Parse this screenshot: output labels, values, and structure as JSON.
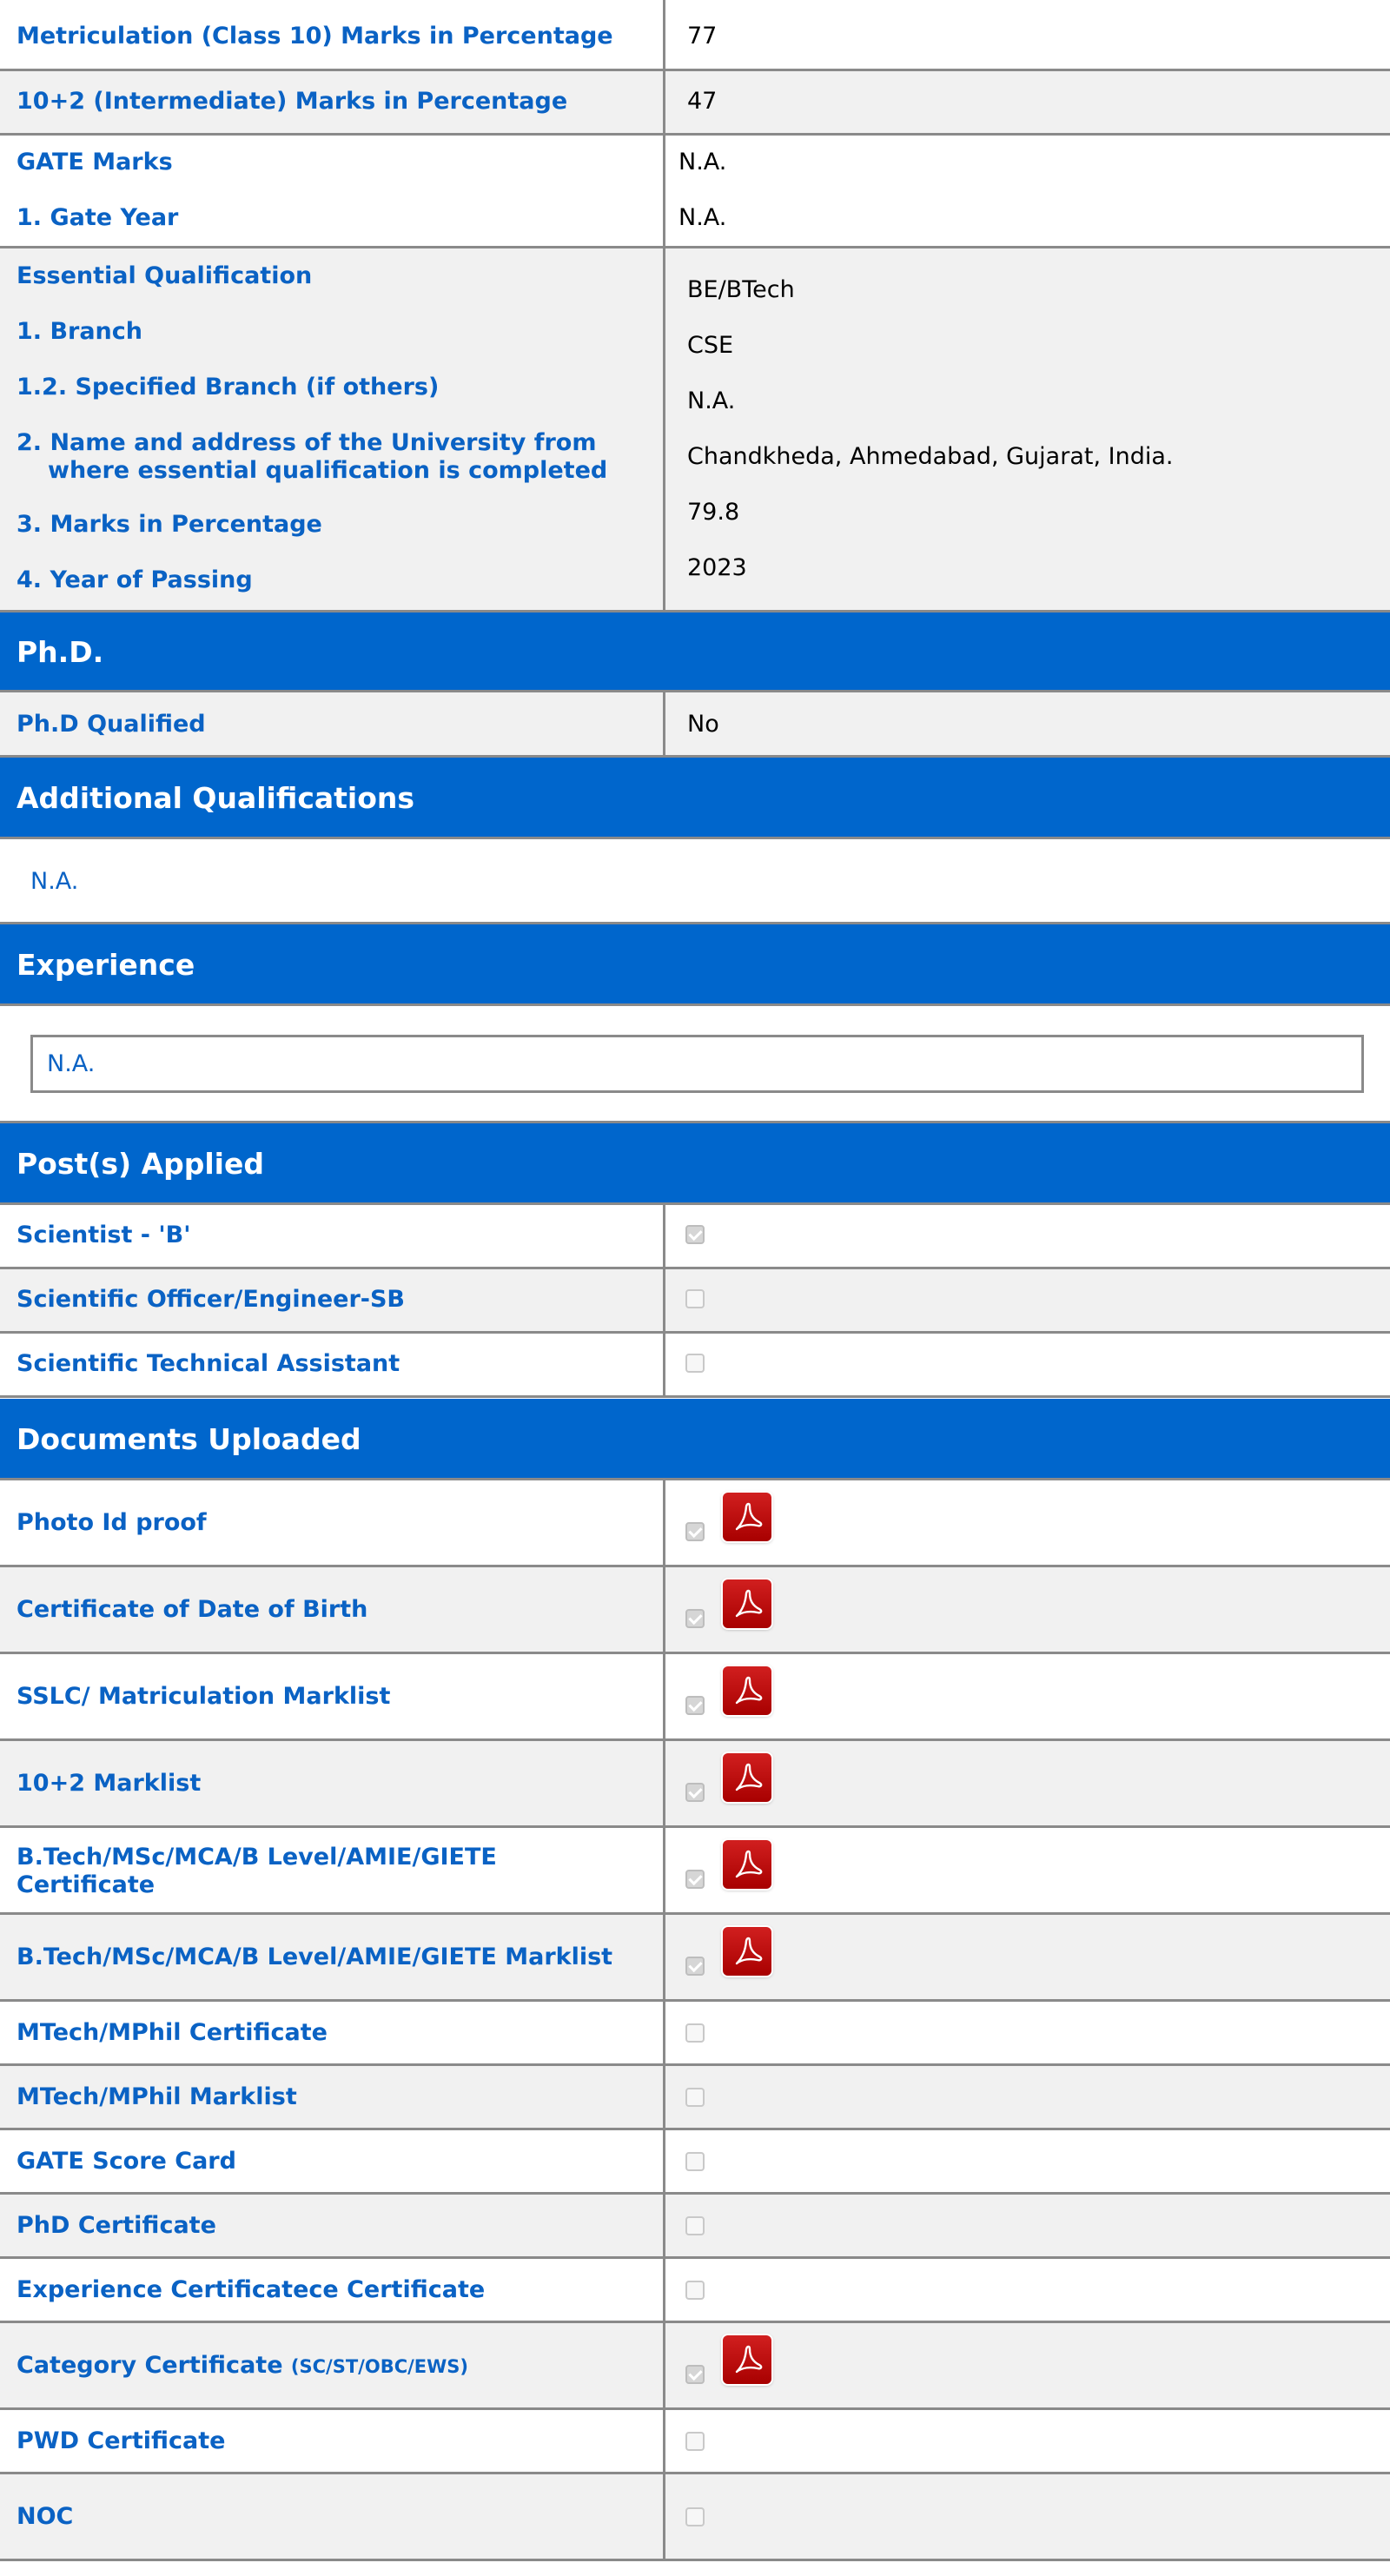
{
  "qualifications": {
    "matriculation_label": "Metriculation (Class 10) Marks in Percentage",
    "matriculation_value": "77",
    "intermediate_label": "10+2 (Intermediate) Marks in Percentage",
    "intermediate_value": "47",
    "gate_marks_label": "GATE Marks",
    "gate_marks_value": "N.A.",
    "gate_year_label": "1. Gate Year",
    "gate_year_value": "N.A.",
    "essential": {
      "heading_label": "Essential Qualification",
      "heading_value": "BE/BTech",
      "branch_label": "1. Branch",
      "branch_value": "CSE",
      "specified_branch_label": "1.2. Specified Branch (if others)",
      "specified_branch_value": "N.A.",
      "university_label_line1": "2. Name and address of the University from",
      "university_label_line2": "where essential qualification is completed",
      "university_value": "Chandkheda, Ahmedabad, Gujarat, India.",
      "marks_label": "3. Marks in Percentage",
      "marks_value": "79.8",
      "year_label": "4. Year of Passing",
      "year_value": "2023"
    }
  },
  "phd": {
    "section_title": "Ph.D.",
    "qualified_label": "Ph.D Qualified",
    "qualified_value": "No"
  },
  "additional": {
    "section_title": "Additional Qualifications",
    "value": "N.A."
  },
  "experience": {
    "section_title": "Experience",
    "value": "N.A."
  },
  "posts": {
    "section_title": "Post(s) Applied",
    "items": [
      {
        "label": "Scientist - 'B'",
        "checked": true
      },
      {
        "label": "Scientific Officer/Engineer-SB",
        "checked": false
      },
      {
        "label": "Scientific Technical Assistant",
        "checked": false
      }
    ]
  },
  "documents": {
    "section_title": "Documents Uploaded",
    "items": [
      {
        "label": "Photo Id proof",
        "checked": true,
        "has_pdf": true
      },
      {
        "label": "Certificate of Date of Birth",
        "checked": true,
        "has_pdf": true
      },
      {
        "label": "SSLC/ Matriculation Marklist",
        "checked": true,
        "has_pdf": true
      },
      {
        "label": "10+2 Marklist",
        "checked": true,
        "has_pdf": true
      },
      {
        "label": "B.Tech/MSc/MCA/B Level/AMIE/GIETE Certificate",
        "checked": true,
        "has_pdf": true
      },
      {
        "label": "B.Tech/MSc/MCA/B Level/AMIE/GIETE Marklist",
        "checked": true,
        "has_pdf": true
      },
      {
        "label": "MTech/MPhil Certificate",
        "checked": false,
        "has_pdf": false
      },
      {
        "label": "MTech/MPhil Marklist",
        "checked": false,
        "has_pdf": false
      },
      {
        "label": "GATE Score Card",
        "checked": false,
        "has_pdf": false
      },
      {
        "label": "PhD Certificate",
        "checked": false,
        "has_pdf": false
      },
      {
        "label": "Experience Certificatece Certificate",
        "checked": false,
        "has_pdf": false
      },
      {
        "label": "Category Certificate",
        "label_suffix": "(SC/ST/OBC/EWS)",
        "checked": true,
        "has_pdf": true
      },
      {
        "label": "PWD Certificate",
        "checked": false,
        "has_pdf": false
      },
      {
        "label": "NOC",
        "checked": false,
        "has_pdf": false
      }
    ]
  },
  "colors": {
    "label_blue": "#0a62c4",
    "section_blue": "#0066cc",
    "row_grey": "#f1f1f1",
    "pdf_red": "#c00000"
  },
  "icons": {
    "pdf": "pdf-file-icon",
    "checkbox": "checkbox"
  }
}
